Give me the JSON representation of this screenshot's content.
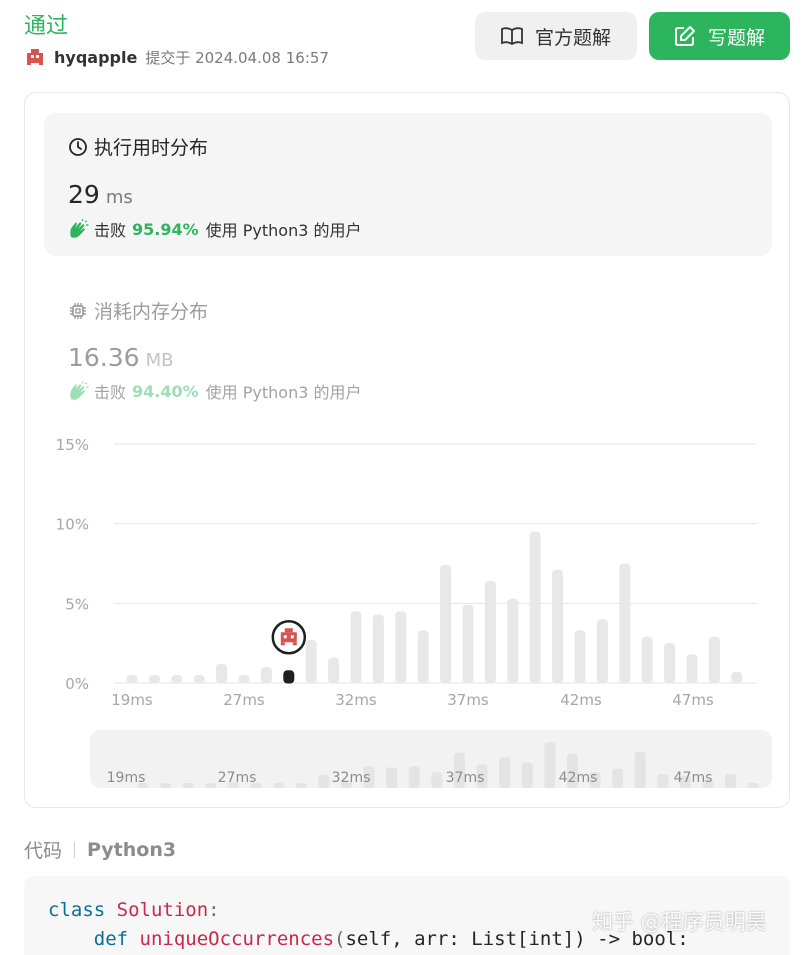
{
  "header": {
    "status": "通过",
    "username": "hyqapple",
    "submitted_at": "提交于 2024.04.08 16:57",
    "official_solution_label": "官方题解",
    "write_solution_label": "写题解"
  },
  "runtime": {
    "title": "执行用时分布",
    "value": "29",
    "unit": "ms",
    "beats_prefix": "击败",
    "beats_pct": "95.94%",
    "beats_suffix": "使用 Python3 的用户"
  },
  "memory": {
    "title": "消耗内存分布",
    "value": "16.36",
    "unit": "MB",
    "beats_prefix": "击败",
    "beats_pct": "94.40%",
    "beats_suffix": "使用 Python3 的用户"
  },
  "chart_data": {
    "type": "bar",
    "y_ticks": [
      "15%",
      "10%",
      "5%",
      "0%"
    ],
    "ylim": [
      0,
      15
    ],
    "x_tick_labels": [
      "19ms",
      "27ms",
      "32ms",
      "37ms",
      "42ms",
      "47ms"
    ],
    "values": [
      0.5,
      0.5,
      0.5,
      0.5,
      1.2,
      0.5,
      1.0,
      0.8,
      2.7,
      1.6,
      4.5,
      4.3,
      4.5,
      3.3,
      7.4,
      4.9,
      6.4,
      5.3,
      9.5,
      7.1,
      3.3,
      4.0,
      7.5,
      2.9,
      2.5,
      1.8,
      2.9,
      0.7
    ],
    "highlight_index": 7,
    "colors": {
      "bar": "#e8e8e8",
      "highlight": "#1f1f1f",
      "grid": "#e6e6e6"
    }
  },
  "code_section": {
    "tab_label": "代码",
    "language": "Python3",
    "line1_kw": "class",
    "line1_name": "Solution",
    "line2_kw": "def",
    "line2_fn": "uniqueOccurrences",
    "line2_args": "self, arr: List[int]) -> bool:"
  },
  "watermark": "知乎 @程序员明昊"
}
